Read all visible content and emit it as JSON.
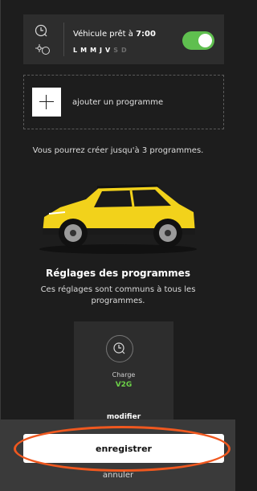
{
  "schedule": {
    "prefix": "Véhicule prêt à",
    "time": "7:00",
    "days_on": [
      "L",
      "M",
      "M",
      "J",
      "V"
    ],
    "days_off": [
      "S",
      "D"
    ],
    "enabled": true,
    "accent": "#5fbf4f"
  },
  "add_program": {
    "label": "ajouter un programme"
  },
  "limit_text": "Vous pourrez créer jusqu'à 3 programmes.",
  "settings": {
    "title": "Réglages des programmes",
    "subtitle": "Ces réglages sont communs à tous les programmes."
  },
  "charge": {
    "label": "Charge",
    "value": "V2G",
    "modify_label": "modifier",
    "value_color": "#6cd148"
  },
  "footer": {
    "save_label": "enregistrer",
    "cancel_label": "annuler",
    "highlight_color": "#f0581f"
  }
}
